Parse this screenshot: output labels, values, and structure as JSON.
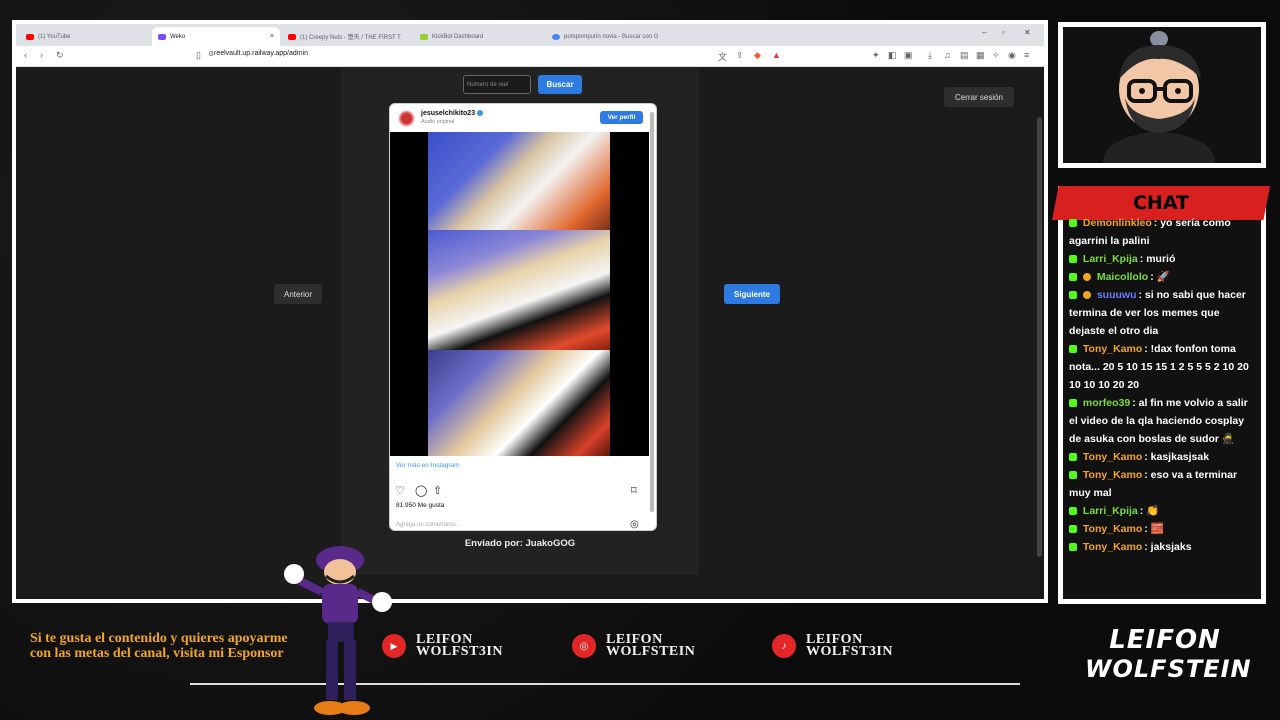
{
  "browser": {
    "tabs": [
      {
        "title": "(1) YouTube",
        "color": "#ff0000",
        "active": false
      },
      {
        "title": "Weko",
        "color": "#7b4cf5",
        "active": true
      },
      {
        "title": "(1) Creepy Nuts - 堕天 / THE FIRST T",
        "color": "#ff0000",
        "active": false
      },
      {
        "title": "KickBot Dashboard",
        "color": "#9acd32",
        "active": false
      },
      {
        "title": "pompompurin novia - Buscar con G",
        "color": "#4285f4",
        "active": false
      }
    ],
    "url": "reelvault.up.railway.app/admin"
  },
  "app": {
    "reel_input_placeholder": "Número de reel",
    "search_label": "Buscar",
    "logout_label": "Cerrar sesión",
    "prev_label": "Anterior",
    "next_label": "Siguiente",
    "sent_by": "Enviado por: JuakoGOG"
  },
  "instagram": {
    "username": "jesuselchikito23",
    "subtitle": "Audio original",
    "view_profile": "Ver perfil",
    "more_link": "Ver más en Instagram",
    "likes": "81.950 Me gusta",
    "comment_placeholder": "Agrega un comentario..."
  },
  "chat": {
    "title": "CHAT",
    "messages": [
      {
        "user": "Demonlinkleo",
        "color": "#f2a623",
        "text": ": yo sería como agarrini la palini"
      },
      {
        "user": "Larri_Kpija",
        "color": "#7cdc43",
        "text": ": murió"
      },
      {
        "user": "Maicollolo",
        "color": "#7cdc43",
        "text": ": 🚀"
      },
      {
        "user": "suuuwu",
        "color": "#6b7bff",
        "text": ": si no sabi que hacer termina de ver los memes que dejaste el otro dia"
      },
      {
        "user": "Tony_Kamo",
        "color": "#f2a623",
        "text": ": !dax fonfon toma nota... 20 5 10 15 15 1 2 5 5 5 2 10 20 10 10 10 20 20"
      },
      {
        "user": "morfeo39",
        "color": "#7cdc43",
        "text": ": al fin me volvio a salir el video de la qla haciendo cosplay de asuka con boslas de sudor 🥷"
      },
      {
        "user": "Tony_Kamo",
        "color": "#f2a623",
        "text": ": kasjkasjsak"
      },
      {
        "user": "Tony_Kamo",
        "color": "#f2a623",
        "text": ": eso va a terminar muy mal"
      },
      {
        "user": "Larri_Kpija",
        "color": "#7cdc43",
        "text": ": 👏"
      },
      {
        "user": "Tony_Kamo",
        "color": "#f2a623",
        "text": ": 🧱"
      },
      {
        "user": "Tony_Kamo",
        "color": "#f2a623",
        "text": ": jaksjaks"
      }
    ]
  },
  "overlay": {
    "promo_text": "Si te gusta el contenido y quieres apoyarme con las metas del canal, visita mi Esponsor",
    "socials": [
      {
        "platform": "youtube-icon",
        "line1": "LEIFON",
        "line2": "WOLFST3IN"
      },
      {
        "platform": "instagram-icon",
        "line1": "LEIFON",
        "line2": "WOLFSTEIN"
      },
      {
        "platform": "tiktok-icon",
        "line1": "LEIFON",
        "line2": "WOLFST3IN"
      }
    ],
    "logo_line1": "LEIFON",
    "logo_line2": "WOLFSTEIN"
  }
}
